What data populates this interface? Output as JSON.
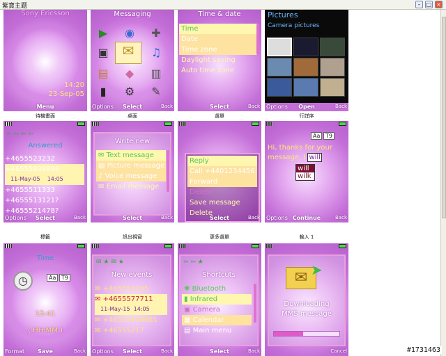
{
  "window": {
    "title": "紫寶主题"
  },
  "watermark": "#1731463",
  "tiles": [
    {
      "caption": "待機畫面",
      "brand": "Sony Ericsson",
      "time": "14:20",
      "date": "23-Sep-05",
      "softkeys": {
        "left": "",
        "mid": "Menu",
        "right": ""
      }
    },
    {
      "caption": "桌面",
      "title": "Messaging",
      "softkeys": {
        "left": "Options",
        "mid": "Select",
        "right": "Back"
      }
    },
    {
      "caption": "選單",
      "title": "Time & date",
      "items": [
        "Time",
        "Date",
        "Time zone",
        "Daylight saving",
        "Auto time zone"
      ],
      "softkeys": {
        "left": "",
        "mid": "Select",
        "right": "Back"
      }
    },
    {
      "caption": "行詳序",
      "title": "Pictures",
      "subtitle": "Camera pictures",
      "softkeys": {
        "left": "Options",
        "mid": "Open",
        "right": "Back"
      }
    },
    {
      "caption": "標籤",
      "title": "Answered",
      "calls": [
        "+4655523232",
        "+46555899898",
        "+4655511333",
        "+4655513121?",
        "+4655521478?"
      ],
      "sel_date": "11-May-05",
      "sel_time": "14:05",
      "softkeys": {
        "left": "Options",
        "mid": "Select",
        "right": "Back"
      }
    },
    {
      "caption": "訊出視窗",
      "title": "Write new",
      "items": [
        "Text message",
        "Picture message",
        "Voice message",
        "Email message"
      ],
      "softkeys": {
        "left": "",
        "mid": "Select",
        "right": "Back"
      }
    },
    {
      "caption": "更多選單",
      "items": [
        "Reply",
        "Call +4401234456",
        "Forward",
        "Delete",
        "Save message",
        "Delete"
      ],
      "softkeys": {
        "left": "",
        "mid": "Select",
        "right": "Back"
      }
    },
    {
      "caption": "輸入 1",
      "text": "Hi, thanks for your message. I",
      "word": "will",
      "suggestions": [
        "will",
        "wilk"
      ],
      "chips": [
        "Aa",
        "T9"
      ],
      "softkeys": {
        "left": "Options",
        "mid": "Continue",
        "right": "Back"
      }
    },
    {
      "caption": "",
      "title": "Time",
      "value": "15:41",
      "format": "( HH:MM )",
      "chips": [
        "Aa",
        "T9"
      ],
      "softkeys": {
        "left": "Format",
        "mid": "Save",
        "right": "Back"
      }
    },
    {
      "caption": "",
      "title": "New events",
      "calls": [
        "+465553235",
        "+4655577711",
        "+46555898981",
        "+46555217"
      ],
      "sel_date": "11-May-15",
      "sel_time": "14:05",
      "softkeys": {
        "left": "Options",
        "mid": "Select",
        "right": "Back"
      }
    },
    {
      "caption": "",
      "title": "Shortcuts",
      "items": [
        "Bluetooth",
        "Infrared",
        "Camera",
        "Calendar",
        "Main menu"
      ],
      "softkeys": {
        "left": "",
        "mid": "Select",
        "right": "Back"
      }
    },
    {
      "caption": "",
      "line1": "Downloading",
      "line2": "MMS message",
      "progress": 0.45,
      "softkeys": {
        "left": "",
        "mid": "",
        "right": "Cancel"
      }
    }
  ]
}
